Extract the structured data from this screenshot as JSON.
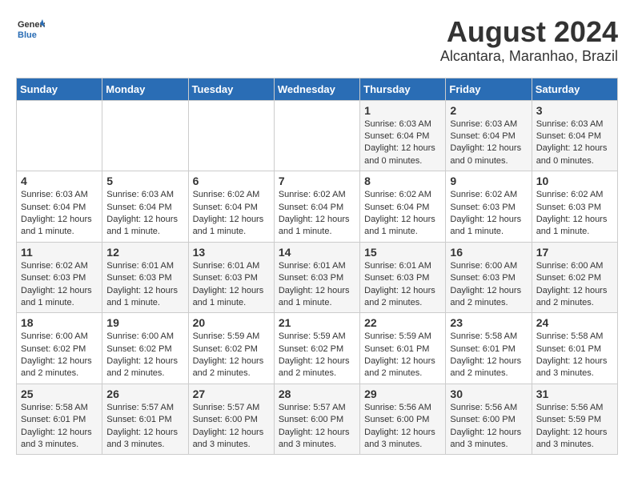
{
  "logo": {
    "general": "General",
    "blue": "Blue"
  },
  "title": "August 2024",
  "subtitle": "Alcantara, Maranhao, Brazil",
  "weekdays": [
    "Sunday",
    "Monday",
    "Tuesday",
    "Wednesday",
    "Thursday",
    "Friday",
    "Saturday"
  ],
  "weeks": [
    [
      {
        "day": "",
        "info": ""
      },
      {
        "day": "",
        "info": ""
      },
      {
        "day": "",
        "info": ""
      },
      {
        "day": "",
        "info": ""
      },
      {
        "day": "1",
        "info": "Sunrise: 6:03 AM\nSunset: 6:04 PM\nDaylight: 12 hours\nand 0 minutes."
      },
      {
        "day": "2",
        "info": "Sunrise: 6:03 AM\nSunset: 6:04 PM\nDaylight: 12 hours\nand 0 minutes."
      },
      {
        "day": "3",
        "info": "Sunrise: 6:03 AM\nSunset: 6:04 PM\nDaylight: 12 hours\nand 0 minutes."
      }
    ],
    [
      {
        "day": "4",
        "info": "Sunrise: 6:03 AM\nSunset: 6:04 PM\nDaylight: 12 hours\nand 1 minute."
      },
      {
        "day": "5",
        "info": "Sunrise: 6:03 AM\nSunset: 6:04 PM\nDaylight: 12 hours\nand 1 minute."
      },
      {
        "day": "6",
        "info": "Sunrise: 6:02 AM\nSunset: 6:04 PM\nDaylight: 12 hours\nand 1 minute."
      },
      {
        "day": "7",
        "info": "Sunrise: 6:02 AM\nSunset: 6:04 PM\nDaylight: 12 hours\nand 1 minute."
      },
      {
        "day": "8",
        "info": "Sunrise: 6:02 AM\nSunset: 6:04 PM\nDaylight: 12 hours\nand 1 minute."
      },
      {
        "day": "9",
        "info": "Sunrise: 6:02 AM\nSunset: 6:03 PM\nDaylight: 12 hours\nand 1 minute."
      },
      {
        "day": "10",
        "info": "Sunrise: 6:02 AM\nSunset: 6:03 PM\nDaylight: 12 hours\nand 1 minute."
      }
    ],
    [
      {
        "day": "11",
        "info": "Sunrise: 6:02 AM\nSunset: 6:03 PM\nDaylight: 12 hours\nand 1 minute."
      },
      {
        "day": "12",
        "info": "Sunrise: 6:01 AM\nSunset: 6:03 PM\nDaylight: 12 hours\nand 1 minute."
      },
      {
        "day": "13",
        "info": "Sunrise: 6:01 AM\nSunset: 6:03 PM\nDaylight: 12 hours\nand 1 minute."
      },
      {
        "day": "14",
        "info": "Sunrise: 6:01 AM\nSunset: 6:03 PM\nDaylight: 12 hours\nand 1 minute."
      },
      {
        "day": "15",
        "info": "Sunrise: 6:01 AM\nSunset: 6:03 PM\nDaylight: 12 hours\nand 2 minutes."
      },
      {
        "day": "16",
        "info": "Sunrise: 6:00 AM\nSunset: 6:03 PM\nDaylight: 12 hours\nand 2 minutes."
      },
      {
        "day": "17",
        "info": "Sunrise: 6:00 AM\nSunset: 6:02 PM\nDaylight: 12 hours\nand 2 minutes."
      }
    ],
    [
      {
        "day": "18",
        "info": "Sunrise: 6:00 AM\nSunset: 6:02 PM\nDaylight: 12 hours\nand 2 minutes."
      },
      {
        "day": "19",
        "info": "Sunrise: 6:00 AM\nSunset: 6:02 PM\nDaylight: 12 hours\nand 2 minutes."
      },
      {
        "day": "20",
        "info": "Sunrise: 5:59 AM\nSunset: 6:02 PM\nDaylight: 12 hours\nand 2 minutes."
      },
      {
        "day": "21",
        "info": "Sunrise: 5:59 AM\nSunset: 6:02 PM\nDaylight: 12 hours\nand 2 minutes."
      },
      {
        "day": "22",
        "info": "Sunrise: 5:59 AM\nSunset: 6:01 PM\nDaylight: 12 hours\nand 2 minutes."
      },
      {
        "day": "23",
        "info": "Sunrise: 5:58 AM\nSunset: 6:01 PM\nDaylight: 12 hours\nand 2 minutes."
      },
      {
        "day": "24",
        "info": "Sunrise: 5:58 AM\nSunset: 6:01 PM\nDaylight: 12 hours\nand 3 minutes."
      }
    ],
    [
      {
        "day": "25",
        "info": "Sunrise: 5:58 AM\nSunset: 6:01 PM\nDaylight: 12 hours\nand 3 minutes."
      },
      {
        "day": "26",
        "info": "Sunrise: 5:57 AM\nSunset: 6:01 PM\nDaylight: 12 hours\nand 3 minutes."
      },
      {
        "day": "27",
        "info": "Sunrise: 5:57 AM\nSunset: 6:00 PM\nDaylight: 12 hours\nand 3 minutes."
      },
      {
        "day": "28",
        "info": "Sunrise: 5:57 AM\nSunset: 6:00 PM\nDaylight: 12 hours\nand 3 minutes."
      },
      {
        "day": "29",
        "info": "Sunrise: 5:56 AM\nSunset: 6:00 PM\nDaylight: 12 hours\nand 3 minutes."
      },
      {
        "day": "30",
        "info": "Sunrise: 5:56 AM\nSunset: 6:00 PM\nDaylight: 12 hours\nand 3 minutes."
      },
      {
        "day": "31",
        "info": "Sunrise: 5:56 AM\nSunset: 5:59 PM\nDaylight: 12 hours\nand 3 minutes."
      }
    ]
  ]
}
